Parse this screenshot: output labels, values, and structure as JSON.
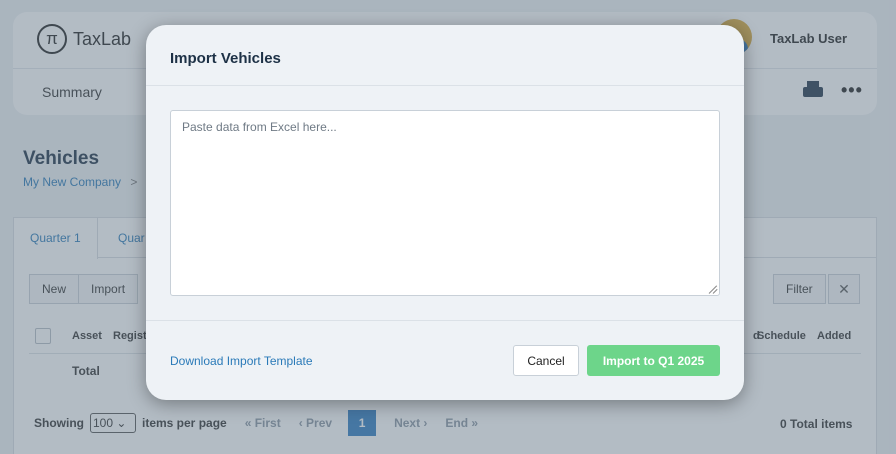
{
  "app": {
    "brand": "TaxLab",
    "user_name": "TaxLab User",
    "nav": {
      "summary": "Summary"
    },
    "page_title": "Vehicles",
    "breadcrumb": {
      "company": "My New Company",
      "separator": ">"
    },
    "tabs": [
      {
        "label": "Quarter 1"
      },
      {
        "label": "Quar"
      }
    ],
    "toolbar": {
      "new_label": "New",
      "import_label": "Import",
      "filter_label": "Filter",
      "clear_label": "✕"
    },
    "table": {
      "headers": {
        "asset": "Asset",
        "regist": "Regist",
        "d": "d",
        "schedule": "Schedule",
        "added": "Added"
      },
      "total_label": "Total"
    },
    "pagination": {
      "showing_label": "Showing",
      "per_page_value": "100",
      "items_per_page_label": "items per page",
      "first": "« First",
      "prev": "‹ Prev",
      "current_page": "1",
      "next": "Next ›",
      "end": "End »",
      "total_items": "0 Total items"
    }
  },
  "modal": {
    "title": "Import Vehicles",
    "textarea_placeholder": "Paste data from Excel here...",
    "textarea_value": "",
    "download_link": "Download Import Template",
    "cancel_label": "Cancel",
    "import_label": "Import to Q1 2025"
  },
  "colors": {
    "accent": "#2f7cc0",
    "import_button": "#6dd58a",
    "link": "#2a7ab8"
  },
  "icons": {
    "logo": "pi-logo-icon",
    "print": "printer-icon",
    "more": "more-horizontal-icon",
    "resize": "resize-grip-icon"
  }
}
